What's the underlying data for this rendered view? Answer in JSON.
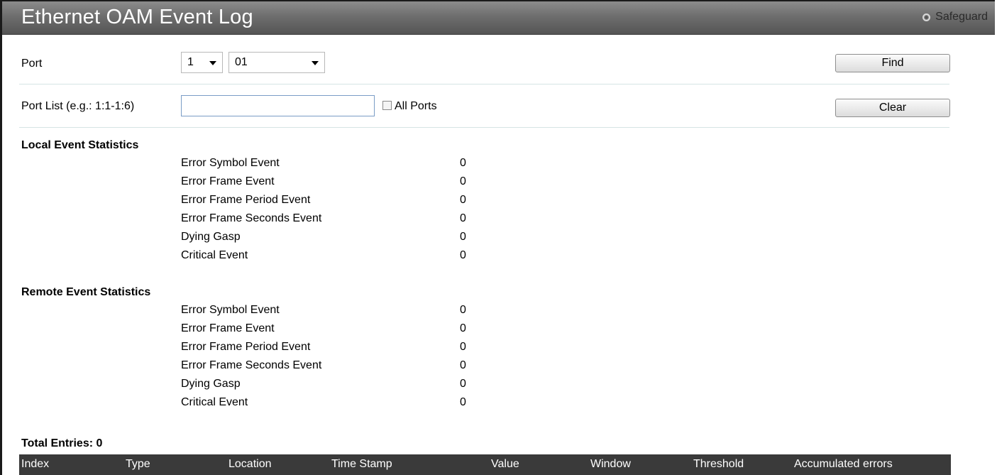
{
  "header": {
    "title": "Ethernet OAM Event Log",
    "safeguard_label": "Safeguard",
    "safeguard_icon": "radio-indicator-icon"
  },
  "form": {
    "port_label": "Port",
    "unit_value": "1",
    "port_value": "01",
    "port_list_label": "Port List (e.g.: 1:1-1:6)",
    "port_list_value": "",
    "all_ports_label": "All Ports",
    "all_ports_checked": false,
    "find_label": "Find",
    "clear_label": "Clear"
  },
  "local": {
    "heading": "Local Event Statistics",
    "rows": [
      {
        "name": "Error Symbol Event",
        "value": "0"
      },
      {
        "name": "Error Frame Event",
        "value": "0"
      },
      {
        "name": "Error Frame Period Event",
        "value": "0"
      },
      {
        "name": "Error Frame Seconds Event",
        "value": "0"
      },
      {
        "name": "Dying Gasp",
        "value": "0"
      },
      {
        "name": "Critical Event",
        "value": "0"
      }
    ]
  },
  "remote": {
    "heading": "Remote Event Statistics",
    "rows": [
      {
        "name": "Error Symbol Event",
        "value": "0"
      },
      {
        "name": "Error Frame Event",
        "value": "0"
      },
      {
        "name": "Error Frame Period Event",
        "value": "0"
      },
      {
        "name": "Error Frame Seconds Event",
        "value": "0"
      },
      {
        "name": "Dying Gasp",
        "value": "0"
      },
      {
        "name": "Critical Event",
        "value": "0"
      }
    ]
  },
  "table": {
    "total_entries": "Total Entries: 0",
    "columns": [
      "Index",
      "Type",
      "Location",
      "Time Stamp",
      "Value",
      "Window",
      "Threshold",
      "Accumulated errors"
    ]
  },
  "colors": {
    "title_bar": "#6e6e6e",
    "table_header": "#3a3a3a",
    "separator": "#d6e4e4"
  }
}
